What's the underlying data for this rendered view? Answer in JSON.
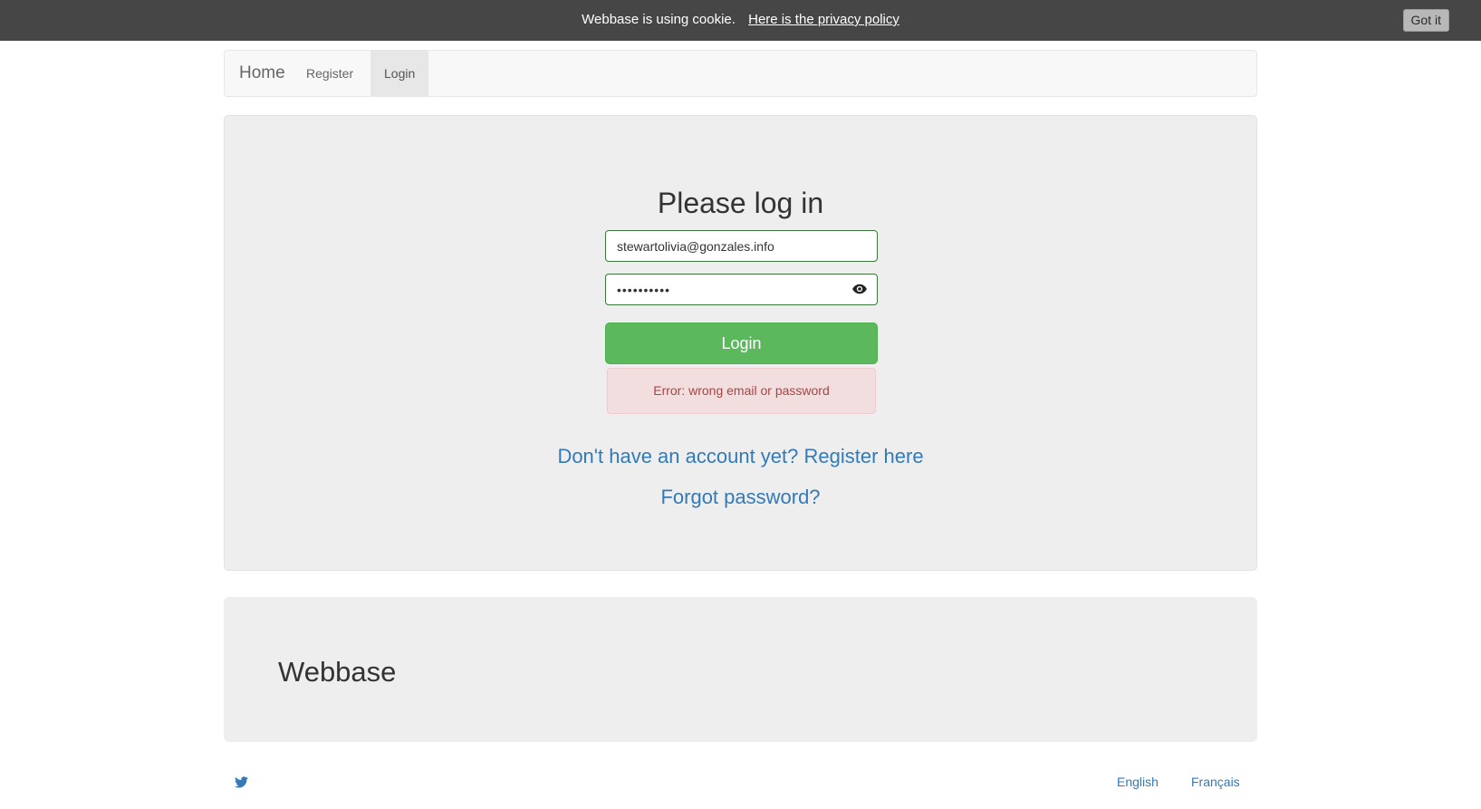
{
  "cookie_bar": {
    "message": "Webbase is using cookie.",
    "privacy_link": "Here is the privacy policy",
    "dismiss_label": "Got it"
  },
  "navbar": {
    "brand": "Home",
    "items": [
      {
        "label": "Register",
        "active": false
      },
      {
        "label": "Login",
        "active": true
      }
    ]
  },
  "login": {
    "title": "Please log in",
    "email_value": "stewartolivia@gonzales.info",
    "password_value": "••••••••••",
    "show_password_icon": "eye-icon",
    "submit_label": "Login",
    "error_message": "Error: wrong email or password",
    "register_link": "Don't have an account yet? Register here",
    "forgot_link": "Forgot password?"
  },
  "footer": {
    "title": "Webbase",
    "social_icon": "twitter-icon",
    "languages": [
      "English",
      "Français"
    ]
  },
  "colors": {
    "cookie_bar_bg": "#464646",
    "primary_button": "#5cb85c",
    "link": "#337ab7",
    "error_text": "#a94442",
    "error_bg": "#f2dede",
    "valid_border": "#3c763d"
  }
}
